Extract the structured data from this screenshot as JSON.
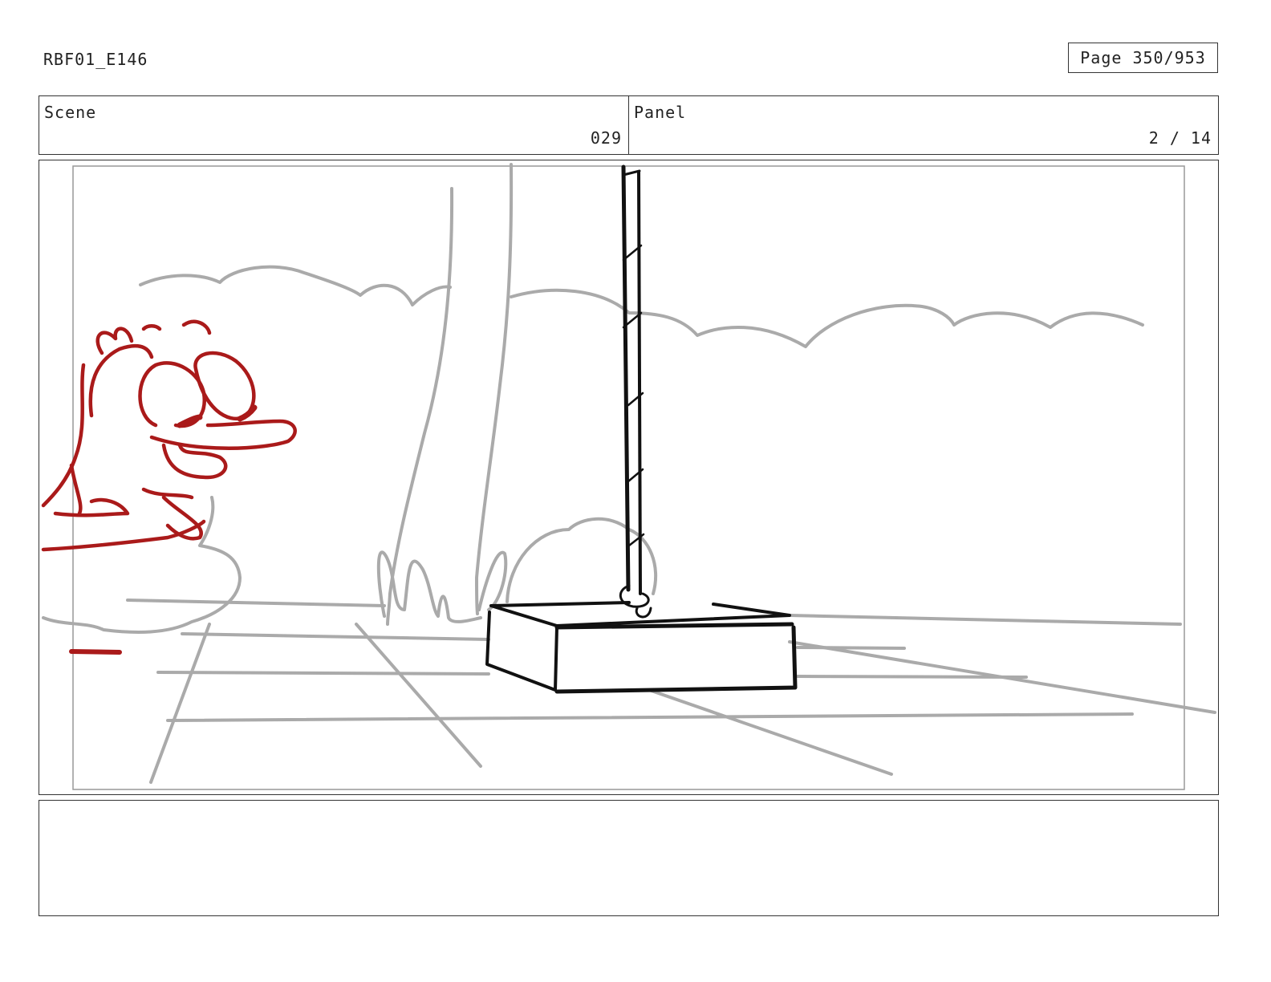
{
  "document": {
    "title": "RBF01_E146",
    "page_label": "Page 350/953"
  },
  "header": {
    "scene_label": "Scene",
    "scene_value": "029",
    "panel_label": "Panel",
    "panel_value": "2 / 14"
  },
  "drawing": {
    "colors": {
      "background_line": "#aaaaaa",
      "character_line": "#aa1a1a",
      "prop_line": "#111111",
      "frame_line": "#999999"
    }
  },
  "notes": {
    "text": ""
  }
}
